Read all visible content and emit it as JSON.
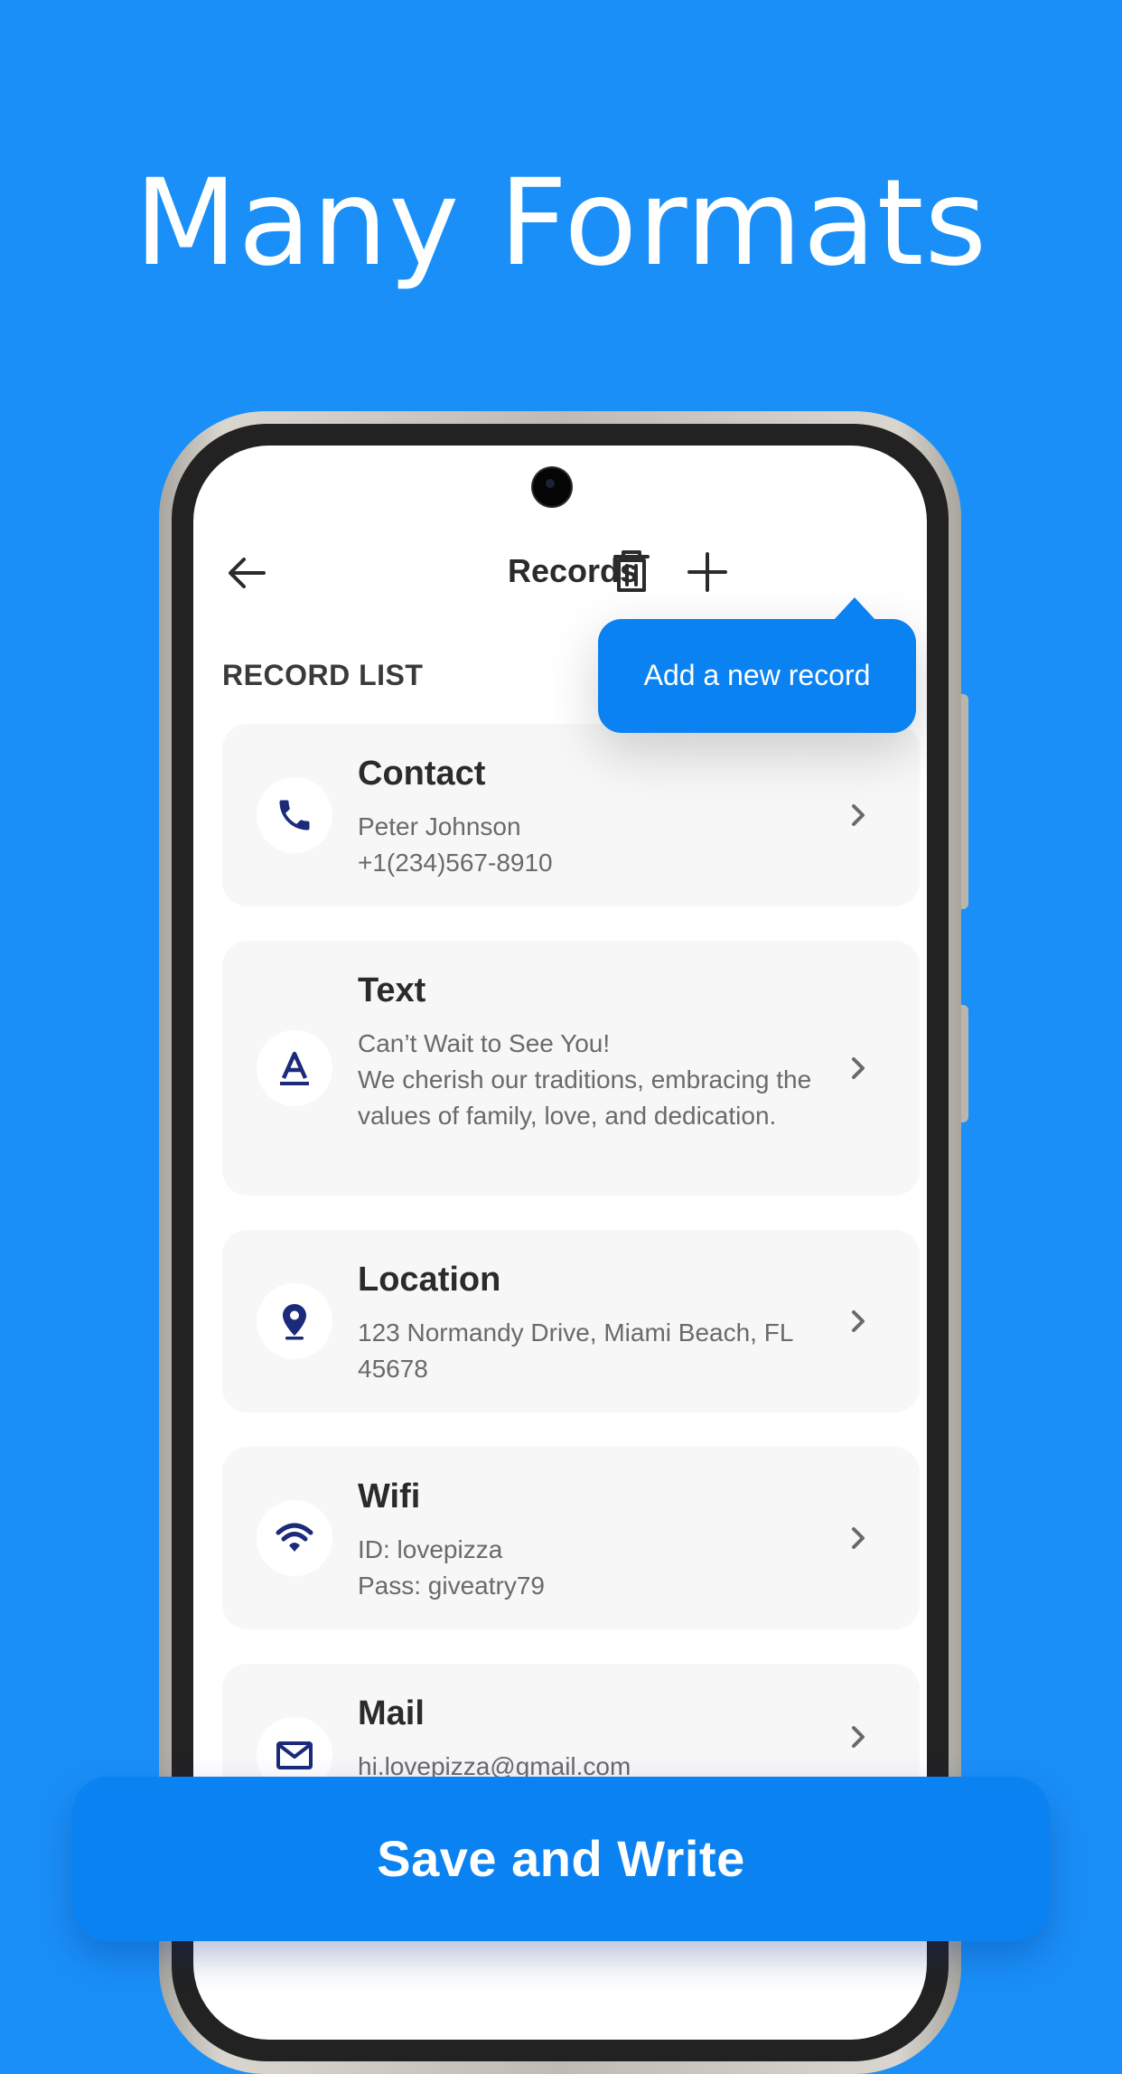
{
  "promo": {
    "headline": "Many Formats"
  },
  "app_bar": {
    "title": "Records"
  },
  "section": {
    "label": "RECORD LIST"
  },
  "tooltip": {
    "text": "Add a new record"
  },
  "records": [
    {
      "title": "Contact",
      "body": "Peter Johnson\n+1(234)567-8910",
      "icon": "phone-icon"
    },
    {
      "title": "Text",
      "body": "Can’t Wait to See You!\nWe cherish our traditions, embracing the values of family, love, and dedication.",
      "icon": "text-format-icon"
    },
    {
      "title": "Location",
      "body": "123 Normandy Drive, Miami Beach, FL 45678",
      "icon": "location-pin-icon"
    },
    {
      "title": "Wifi",
      "body": "ID: lovepizza\nPass: giveatry79",
      "icon": "wifi-icon"
    },
    {
      "title": "Mail",
      "body": "hi.lovepizza@gmail.com",
      "icon": "mail-icon"
    }
  ],
  "actions": {
    "save_write": "Save and Write"
  },
  "colors": {
    "background": "#1a8ff8",
    "accent": "#0a82f2",
    "icon": "#1b2a7a",
    "card": "#f7f7f7"
  }
}
